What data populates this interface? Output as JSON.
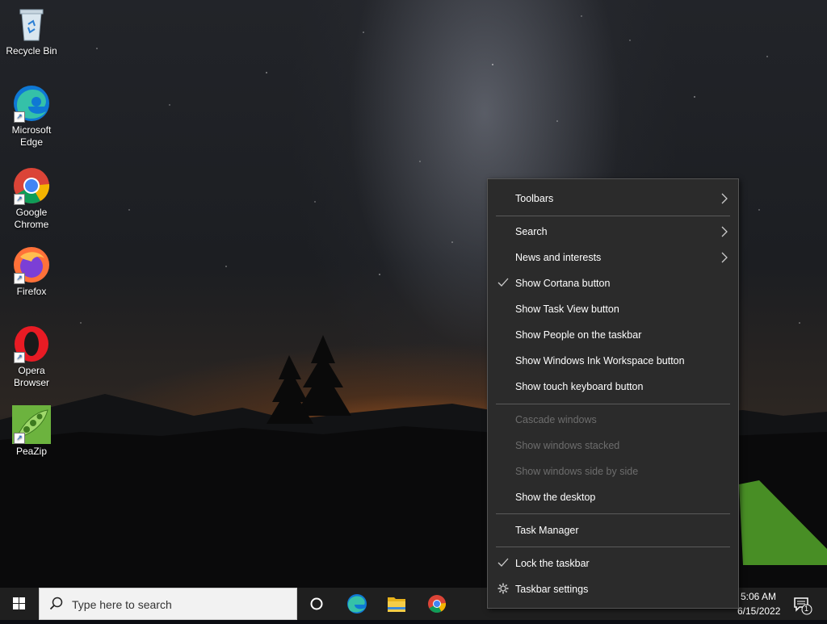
{
  "desktop": {
    "icons": [
      {
        "label": "Recycle Bin"
      },
      {
        "label": "Microsoft\nEdge"
      },
      {
        "label": "Google\nChrome"
      },
      {
        "label": "Firefox"
      },
      {
        "label": "Opera\nBrowser"
      },
      {
        "label": "PeaZip"
      }
    ]
  },
  "context_menu": {
    "items": [
      {
        "label": "Toolbars",
        "submenu": true
      },
      {
        "label": "Search",
        "submenu": true
      },
      {
        "label": "News and interests",
        "submenu": true
      },
      {
        "label": "Show Cortana button",
        "checked": true
      },
      {
        "label": "Show Task View button"
      },
      {
        "label": "Show People on the taskbar"
      },
      {
        "label": "Show Windows Ink Workspace button"
      },
      {
        "label": "Show touch keyboard button"
      },
      {
        "label": "Cascade windows",
        "disabled": true
      },
      {
        "label": "Show windows stacked",
        "disabled": true
      },
      {
        "label": "Show windows side by side",
        "disabled": true
      },
      {
        "label": "Show the desktop"
      },
      {
        "label": "Task Manager"
      },
      {
        "label": "Lock the taskbar",
        "checked": true
      },
      {
        "label": "Taskbar settings",
        "icon": "gear-icon"
      }
    ]
  },
  "taskbar": {
    "search_placeholder": "Type here to search",
    "time": "5:06 AM",
    "date": "6/15/2022",
    "notification_count": "1"
  },
  "colors": {
    "menu_bg": "#2b2b2b",
    "menu_disabled": "#6d6d6d",
    "taskbar_bg": "#1f1f1f"
  }
}
